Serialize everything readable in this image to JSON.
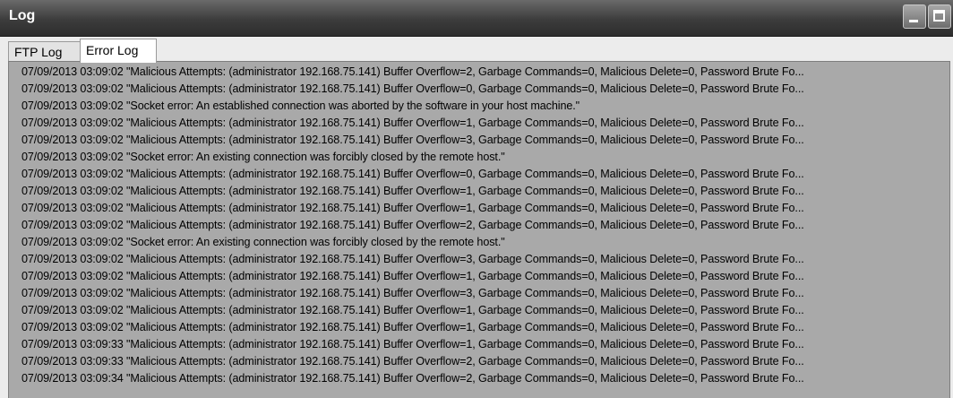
{
  "window": {
    "title": "Log"
  },
  "tabs": [
    {
      "label": "FTP Log"
    },
    {
      "label": "Error Log"
    }
  ],
  "log": {
    "lines": [
      "07/09/2013 03:09:02 \"Malicious Attempts: (administrator 192.168.75.141) Buffer Overflow=2, Garbage Commands=0, Malicious Delete=0, Password Brute Fo...",
      "07/09/2013 03:09:02 \"Malicious Attempts: (administrator 192.168.75.141) Buffer Overflow=0, Garbage Commands=0, Malicious Delete=0, Password Brute Fo...",
      "07/09/2013 03:09:02 \"Socket error: An established connection was aborted by the software in your host machine.\"",
      "07/09/2013 03:09:02 \"Malicious Attempts: (administrator 192.168.75.141) Buffer Overflow=1, Garbage Commands=0, Malicious Delete=0, Password Brute Fo...",
      "07/09/2013 03:09:02 \"Malicious Attempts: (administrator 192.168.75.141) Buffer Overflow=3, Garbage Commands=0, Malicious Delete=0, Password Brute Fo...",
      "07/09/2013 03:09:02 \"Socket error: An existing connection was forcibly closed by the remote host.\"",
      "07/09/2013 03:09:02 \"Malicious Attempts: (administrator 192.168.75.141) Buffer Overflow=0, Garbage Commands=0, Malicious Delete=0, Password Brute Fo...",
      "07/09/2013 03:09:02 \"Malicious Attempts: (administrator 192.168.75.141) Buffer Overflow=1, Garbage Commands=0, Malicious Delete=0, Password Brute Fo...",
      "07/09/2013 03:09:02 \"Malicious Attempts: (administrator 192.168.75.141) Buffer Overflow=1, Garbage Commands=0, Malicious Delete=0, Password Brute Fo...",
      "07/09/2013 03:09:02 \"Malicious Attempts: (administrator 192.168.75.141) Buffer Overflow=2, Garbage Commands=0, Malicious Delete=0, Password Brute Fo...",
      "07/09/2013 03:09:02 \"Socket error: An existing connection was forcibly closed by the remote host.\"",
      "07/09/2013 03:09:02 \"Malicious Attempts: (administrator 192.168.75.141) Buffer Overflow=3, Garbage Commands=0, Malicious Delete=0, Password Brute Fo...",
      "07/09/2013 03:09:02 \"Malicious Attempts: (administrator 192.168.75.141) Buffer Overflow=1, Garbage Commands=0, Malicious Delete=0, Password Brute Fo...",
      "07/09/2013 03:09:02 \"Malicious Attempts: (administrator 192.168.75.141) Buffer Overflow=3, Garbage Commands=0, Malicious Delete=0, Password Brute Fo...",
      "07/09/2013 03:09:02 \"Malicious Attempts: (administrator 192.168.75.141) Buffer Overflow=1, Garbage Commands=0, Malicious Delete=0, Password Brute Fo...",
      "07/09/2013 03:09:02 \"Malicious Attempts: (administrator 192.168.75.141) Buffer Overflow=1, Garbage Commands=0, Malicious Delete=0, Password Brute Fo...",
      "07/09/2013 03:09:33 \"Malicious Attempts: (administrator 192.168.75.141) Buffer Overflow=1, Garbage Commands=0, Malicious Delete=0, Password Brute Fo...",
      "07/09/2013 03:09:33 \"Malicious Attempts: (administrator 192.168.75.141) Buffer Overflow=2, Garbage Commands=0, Malicious Delete=0, Password Brute Fo...",
      "07/09/2013 03:09:34 \"Malicious Attempts: (administrator 192.168.75.141) Buffer Overflow=2, Garbage Commands=0, Malicious Delete=0, Password Brute Fo..."
    ]
  },
  "icons": {
    "minimize": "minimize-icon",
    "maximize": "maximize-icon"
  },
  "colors": {
    "titlebar": "#3c3c3c",
    "log_background": "#a9a9a9",
    "active_tab": "#ffffff"
  }
}
